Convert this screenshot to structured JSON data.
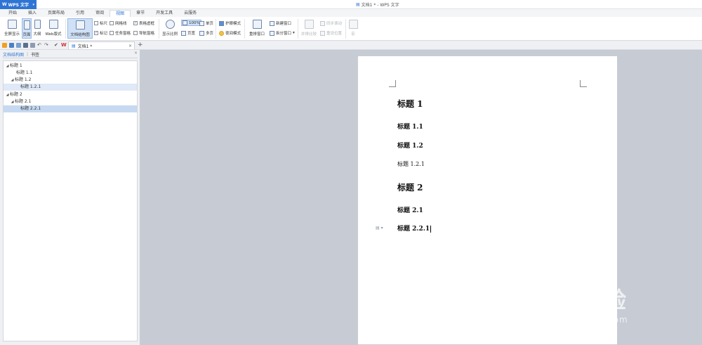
{
  "app": {
    "name": "WPS 文字",
    "window_title": "文档1 * - WPS 文字"
  },
  "ribbon_tabs": [
    "开始",
    "插入",
    "页面布局",
    "引用",
    "审阅",
    "视图",
    "章节",
    "开发工具",
    "云服务"
  ],
  "active_tab": "视图",
  "ribbon": {
    "full_screen": "全屏显示",
    "page_view": "页面",
    "outline": "大纲",
    "web_layout": "Web版式",
    "doc_structure": "文档结构图",
    "ruler": "标尺",
    "gridlines": "网格线",
    "table_gridlines": "表格虚框",
    "marks": "标记",
    "task_pane": "任务窗格",
    "nav_pane": "导航窗格",
    "zoom": "显示比例",
    "zoom_100": "100%",
    "one_page": "单页",
    "page_width": "页宽",
    "multi_page": "多页",
    "eye_protect": "护眼模式",
    "night_mode": "夜间模式",
    "arrange_window": "重排窗口",
    "new_window": "新建窗口",
    "split_window": "拆分窗口",
    "side_by_side": "并排比较",
    "sync_scroll": "同步滚动",
    "reset_position": "重设位置",
    "macro": "宏"
  },
  "doc_tab": {
    "title": "文档1 *",
    "close": "×",
    "add": "+"
  },
  "nav": {
    "tab_structure": "文档结构图",
    "tab_bookmarks": "书签",
    "close": "×",
    "nodes": [
      {
        "label": "标题 1",
        "expander": "◢"
      },
      {
        "label": "标题 1.1",
        "expander": ""
      },
      {
        "label": "标题 1.2",
        "expander": "◢"
      },
      {
        "label": "标题 1.2.1",
        "expander": ""
      },
      {
        "label": "标题 2",
        "expander": "◢"
      },
      {
        "label": "标题 2.1",
        "expander": "◢"
      },
      {
        "label": "标题 2.2.1",
        "expander": ""
      }
    ]
  },
  "document": {
    "headings": [
      "标题 1",
      "标题 1.1",
      "标题 1.2",
      "标题 1.2.1",
      "标题 2",
      "标题 2.1",
      "标题 2.2.1"
    ]
  },
  "watermark": {
    "brand": "Bai经验",
    "url": "jingyan.baidu.com"
  },
  "colors": {
    "accent": "#2e74d5",
    "nav_selected": "#c6d9f1",
    "workspace": "#c6cbd4"
  }
}
